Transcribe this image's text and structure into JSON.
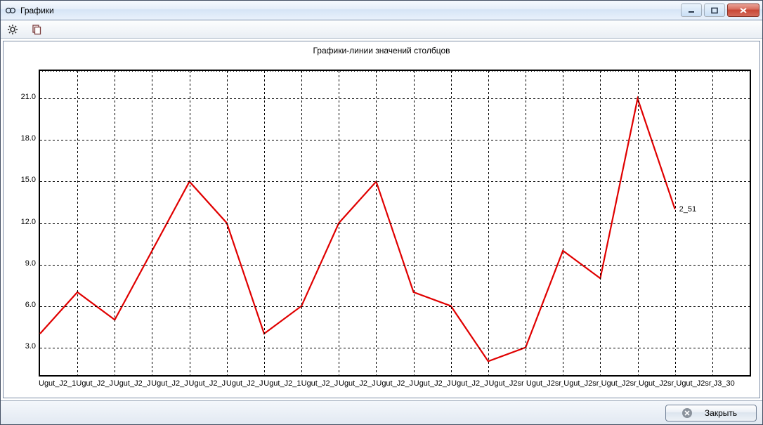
{
  "window": {
    "title": "Графики",
    "buttons": {
      "minimize": "minimize",
      "maximize": "maximize",
      "close": "close"
    }
  },
  "toolbar": {
    "settings_icon": "gear-icon",
    "copy_icon": "copy-icon"
  },
  "footer": {
    "close_label": "Закрыть"
  },
  "series_end_label": "2_51",
  "chart_data": {
    "type": "line",
    "title": "Графики-линии значений столбцов",
    "xlabel": "",
    "ylabel": "",
    "ylim": [
      1,
      23
    ],
    "yticks": [
      3.0,
      6.0,
      9.0,
      12.0,
      15.0,
      18.0,
      21.0
    ],
    "categories": [
      "Ugut_J2_1",
      "Ugut_J2_J",
      "Ugut_J2_J",
      "Ugut_J2_J",
      "Ugut_J2_J",
      "Ugut_J2_J2s",
      "Ugut_J2_1",
      "Ugut_J2_J",
      "Ugut_J2_J",
      "Ugut_J2_J",
      "Ugut_J2_J",
      "Ugut_J2_J",
      "Ugut_J2sr",
      "Ugut_J2sr_",
      "Ugut_J2sr_",
      "Ugut_J2sr_",
      "Ugut_J2sr_",
      "Ugut_J2sr_",
      "J3_30"
    ],
    "values": [
      4,
      7,
      5,
      10,
      15,
      12,
      4,
      6,
      12,
      15,
      7,
      6,
      2,
      3,
      10,
      8,
      21,
      13
    ],
    "series_name": "J2_51",
    "annotations": [
      {
        "text": "2_51",
        "x_index_after_last": true
      }
    ]
  }
}
